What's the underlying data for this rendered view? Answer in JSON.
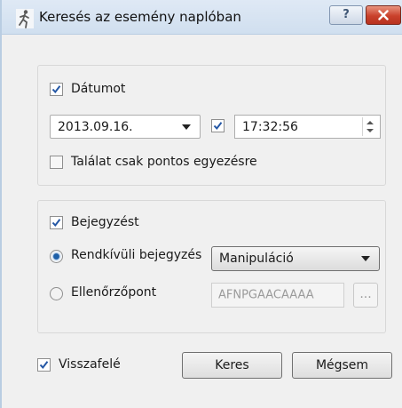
{
  "window": {
    "title": "Keresés az esemény naplóban",
    "help_label": "?",
    "icon": "running-person-icon"
  },
  "date_group": {
    "date_check_label": "Dátumot",
    "date_checked": true,
    "date_value": "2013.09.16.",
    "time_checked": true,
    "time_value": "17:32:56",
    "exact_match_label": "Találat csak pontos egyezésre",
    "exact_match_checked": false
  },
  "entry_group": {
    "entry_check_label": "Bejegyzést",
    "entry_checked": true,
    "radio_special_label": "Rendkívüli bejegyzés",
    "radio_special_selected": true,
    "special_select_value": "Manipuláció",
    "radio_checkpoint_label": "Ellenőrzőpont",
    "radio_checkpoint_selected": false,
    "checkpoint_value": "AFNPGAACAAAA",
    "browse_label": "..."
  },
  "footer": {
    "backward_label": "Visszafelé",
    "backward_checked": true,
    "search_label": "Keres",
    "cancel_label": "Mégsem"
  },
  "colors": {
    "check_mark": "#2457a5",
    "close_button": "#c9412b",
    "title_bar": "#d6e3f1"
  }
}
